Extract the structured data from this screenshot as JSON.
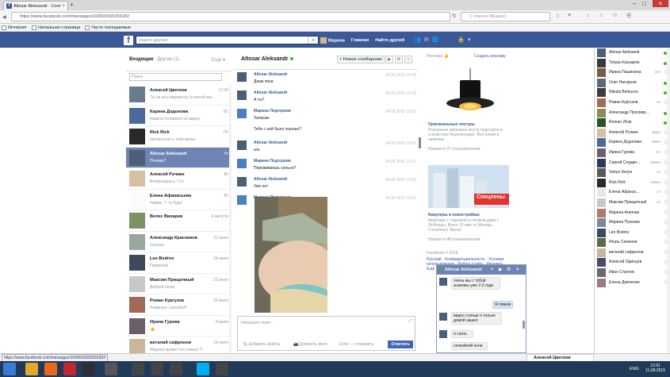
{
  "browser": {
    "tab_title": "Altosar Aleksandr - Сообщ...",
    "url": "https://www.facebook.com/messages/100001500259182",
    "search_placeholder": "С поиска (Яндекс)",
    "bookmarks": [
      "Интернет",
      "Начальная страница",
      "Часто посещаемые"
    ]
  },
  "fb_header": {
    "search_placeholder": "Ищите друзей",
    "nav": [
      "Марина",
      "Главная",
      "Найти друзей"
    ]
  },
  "left_panel": {
    "inbox_label": "Входящие",
    "other_label": "Другие (1)",
    "more_label": "Ещё ▾",
    "search_placeholder": "Поиск",
    "conversations": [
      {
        "name": "Алексей Цветков",
        "preview": "Ты на все перевесну (о меной мы ...",
        "time": "12:30",
        "color": "#6a7b8c"
      },
      {
        "name": "Карина Додонова",
        "preview": "Карина отправил(-а) видео.",
        "time": "Вс",
        "color": "#4a6a9b"
      },
      {
        "name": "Rick Rick",
        "preview": "интересная у тебя жизнь",
        "time": "Пт",
        "color": "#2a2a2a"
      },
      {
        "name": "Altosar Aleksandr",
        "preview": "Почему?",
        "time": "Чт",
        "color": "#4b6076"
      },
      {
        "name": "Алексей Ручкин",
        "preview": "Возвращаюсь 7-го",
        "time": "Вт",
        "color": "#d6c0a2"
      },
      {
        "name": "Елена Афанасьева",
        "preview": "Нафик, Т-то буду!",
        "time": "Вт",
        "color": "#fbfbfb"
      },
      {
        "name": "Велес Вихарев",
        "preview": "",
        "time": "4 августа",
        "color": "#7d9165"
      },
      {
        "name": "Александр Красников",
        "preview": "Хорошо",
        "time": "31 июля",
        "color": "#9aa7a0"
      },
      {
        "name": "Leo Bodrov",
        "preview": "Приветик)",
        "time": "24 июля",
        "color": "#3e4a5a"
      },
      {
        "name": "Максим Прищепный",
        "preview": "Доброй ночи)",
        "time": "23 июля",
        "color": "#c8c8c8"
      },
      {
        "name": "Роман Кургузов",
        "preview": "Романыч, спасибо!!!",
        "time": "20 июля",
        "color": "#a06a55"
      },
      {
        "name": "Ирина Гурова",
        "preview": "👍",
        "time": "9 июля",
        "color": "#6b5f6a"
      },
      {
        "name": "виталий сафронов",
        "preview": "Марина привет что нового !?",
        "time": "16 июля",
        "color": "#c9b79b"
      }
    ]
  },
  "thread": {
    "title": "Altosar Aleksandr",
    "new_message_label": "+ Новое сообщение",
    "messages": [
      {
        "name": "Altosar Aleksandr",
        "text": "Дома пока",
        "time": "04.08.2015 12:43",
        "color": "#4b6076"
      },
      {
        "name": "Altosar Aleksandr",
        "text": "А ты?",
        "time": "04.08.2015 12:43",
        "color": "#4b6076"
      },
      {
        "name": "Марина Подгорная",
        "text": "Загораю",
        "time": "04.08.2015 13:00",
        "color": "#4a7fc1"
      },
      {
        "name": "",
        "text": "Тебе с ней было хорошо?",
        "time": "",
        "color": ""
      },
      {
        "name": "Altosar Aleksandr",
        "text": "ага",
        "time": "04.08.2015 13:01",
        "color": "#4b6076"
      },
      {
        "name": "Марина Подгорная",
        "text": "Переживаешь сильно?",
        "time": "04.08.2015 13:17",
        "color": "#4a7fc1"
      },
      {
        "name": "Altosar Aleksandr",
        "text": "Уже нет",
        "time": "04.08.2015 13:20",
        "color": "#4b6076"
      },
      {
        "name": "Марина Подгорная",
        "text": "",
        "time": "04.08.2015 13:20",
        "color": "#4a7fc1"
      }
    ],
    "compose_placeholder": "Напишите ответ...",
    "add_files": "Добавить файлы",
    "add_photo": "Добавить фото",
    "enter_hint": "Enter — отправить",
    "send_label": "Ответить"
  },
  "ads": {
    "header": "Реклама",
    "create_ad": "Создать рекламу",
    "ad1_title": "Оригинальные люстры",
    "ad1_desc": "Розничные магазины люстр подстарта в стилистике Regenboogen. Вся линии в наличии.",
    "ad1_likes": "Нравится 27 пользователям",
    "ad2_title": "Квартиры в новостройках",
    "ad2_desc": "Квартиры с отделкой в готовом доме г. Люберцы. Всего 15 мин от Москвы. Спецпены! Звони!",
    "ad2_likes": "Нравится 48 пользователям",
    "ad2_banner": "Спецпены",
    "footer_copy": "Facebook © 2015",
    "footer_links": "Русский · Конфиденциальность · Условия использования · Файлы cookie · Реклама · Ещё ▾"
  },
  "chat_popup": {
    "title": "Altosar Aleksandr",
    "bubbles": [
      {
        "text": "очень мы с тобой знакомы уже 2-3 года",
        "side": "left"
      },
      {
        "text": "Я помню",
        "side": "right"
      },
      {
        "text": "видно солнце я только домой зашел",
        "side": "left"
      },
      {
        "text": "я спать",
        "side": "left"
      },
      {
        "text": "спокойной ночи",
        "side": "left"
      }
    ]
  },
  "chat_sidebar": {
    "contacts": [
      {
        "name": "Altosar Aleksandr",
        "status": "",
        "online": true,
        "color": "#4b6076"
      },
      {
        "name": "Тигран Кахзарян",
        "status": "",
        "online": true,
        "color": "#3a3a3a"
      },
      {
        "name": "Ирина Пашинина",
        "status": "18ч",
        "online": false,
        "color": "#7a5b4a"
      },
      {
        "name": "Олег Нагорнов",
        "status": "",
        "online": true,
        "color": "#5a6a7a"
      },
      {
        "name": "Nikolai Belousov",
        "status": "",
        "online": true,
        "color": "#3c3c3c"
      },
      {
        "name": "Роман Кургузов",
        "status": "5ч",
        "online": false,
        "color": "#a06a55"
      },
      {
        "name": "Александр Просвир...",
        "status": "",
        "online": true,
        "color": "#8b8b5a"
      },
      {
        "name": "Roman Zhuk",
        "status": "",
        "online": true,
        "color": "#2f4f2f"
      },
      {
        "name": "Алексей Ручкин",
        "status": "9мин",
        "online": false,
        "color": "#d6c0a2"
      },
      {
        "name": "Карина Додонова",
        "status": "3мин",
        "online": false,
        "color": "#4a6a9b"
      },
      {
        "name": "Ирина Гурова",
        "status": "5ч",
        "online": false,
        "color": "#6b5f6a"
      },
      {
        "name": "Сергей Слудин...",
        "status": "15мин",
        "online": false,
        "color": "#2a3a5a"
      },
      {
        "name": "Vanya Vanya",
        "status": "2ч",
        "online": false,
        "color": "#5a5a5a"
      },
      {
        "name": "Rick Rick",
        "status": "14мин",
        "online": false,
        "color": "#2a2a2a"
      },
      {
        "name": "Елена Афанас...",
        "status": "1ч",
        "online": false,
        "color": "#e8e8e8"
      },
      {
        "name": "Максим Прищепный",
        "status": "4ч",
        "online": false,
        "color": "#c8c8c8"
      },
      {
        "name": "Марина Агапова",
        "status": "",
        "online": false,
        "color": "#b07a6a"
      },
      {
        "name": "Марина Пункова",
        "status": "",
        "online": false,
        "color": "#7a8a9a"
      },
      {
        "name": "Leo Bodrov",
        "status": "",
        "online": false,
        "color": "#3e4a5a"
      },
      {
        "name": "Игорь Семенов",
        "status": "",
        "online": false,
        "color": "#5a6a4a"
      },
      {
        "name": "виталий сафронов",
        "status": "",
        "online": false,
        "color": "#c9b79b"
      },
      {
        "name": "Алексей Одинцов",
        "status": "",
        "online": false,
        "color": "#4a4a6a"
      },
      {
        "name": "Иван Строгов",
        "status": "",
        "online": false,
        "color": "#6a6a6a"
      },
      {
        "name": "Елена Демченко",
        "status": "",
        "online": false,
        "color": "#9a7a8a"
      }
    ]
  },
  "status": {
    "hover_url": "https://www.facebook.com/messages/100001500259182#",
    "chat_tab": "Алексей Цветков",
    "time": "12:51",
    "date": "11.08.2015",
    "lang": "ENG"
  }
}
